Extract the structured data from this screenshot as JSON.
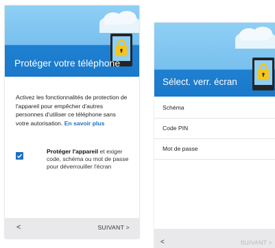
{
  "screen1": {
    "title": "Protéger votre téléphone",
    "description": "Activez les fonctionnalités de protection de l'appareil pour empêcher d'autres personnes d'utiliser ce téléphone sans votre autorisation.",
    "learn_more": "En savoir plus",
    "checkbox_bold": "Protéger l'appareil",
    "checkbox_text": " et exiger code, schéma ou mot de passe pour déverrouiller l'écran",
    "back_label": "<",
    "next_label": "SUIVANT  >"
  },
  "screen2": {
    "title": "Sélect. verr. écran",
    "options": [
      "Schéma",
      "Code PIN",
      "Mot de passe"
    ],
    "back_label": "<",
    "next_label": "SUIVANT  >"
  },
  "colors": {
    "header_blue": "#1a79cb",
    "sky": "#8fcff5",
    "lock_yellow": "#f5c518",
    "checkbox": "#1e6fc4"
  }
}
